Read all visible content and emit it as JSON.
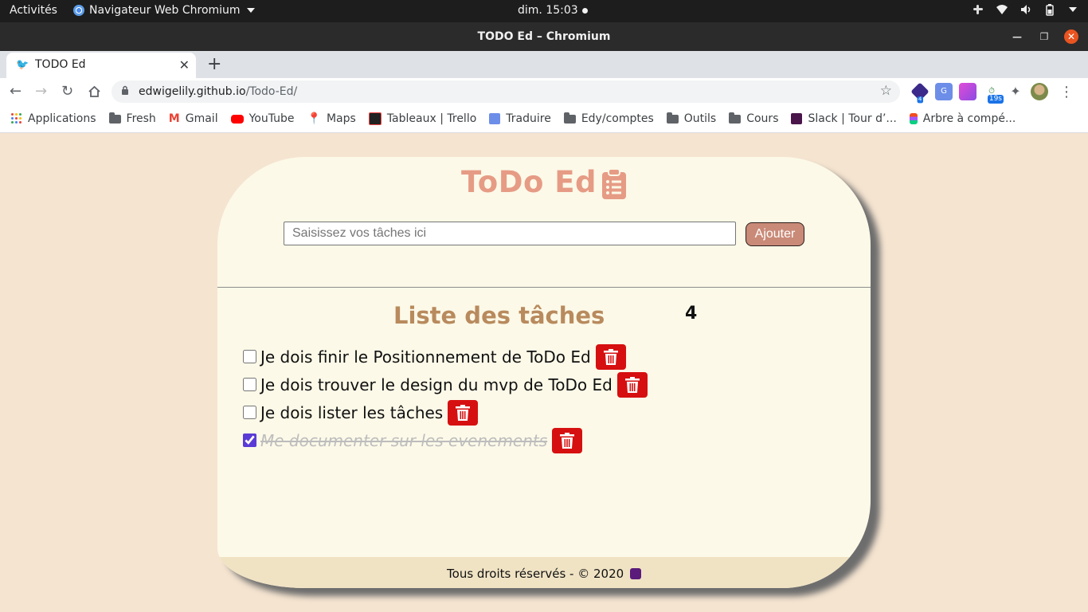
{
  "system": {
    "activities": "Activités",
    "app_name": "Navigateur Web Chromium",
    "clock": "dim. 15:03"
  },
  "window": {
    "title": "TODO Ed – Chromium"
  },
  "tabs": [
    {
      "label": "TODO Ed"
    }
  ],
  "toolbar": {
    "url_host": "edwigelily.github.io",
    "url_path": "/Todo-Ed/",
    "extension_badges": {
      "ext1": "4",
      "ext5": "19s"
    }
  },
  "bookmarks": [
    {
      "label": "Applications",
      "icon": "apps-grid-icon"
    },
    {
      "label": "Fresh",
      "icon": "folder-icon"
    },
    {
      "label": "Gmail",
      "icon": "gmail-icon"
    },
    {
      "label": "YouTube",
      "icon": "youtube-icon"
    },
    {
      "label": "Maps",
      "icon": "maps-icon"
    },
    {
      "label": "Tableaux | Trello",
      "icon": "trello-icon"
    },
    {
      "label": "Traduire",
      "icon": "translate-icon"
    },
    {
      "label": "Edy/comptes",
      "icon": "folder-icon"
    },
    {
      "label": "Outils",
      "icon": "folder-icon"
    },
    {
      "label": "Cours",
      "icon": "folder-icon"
    },
    {
      "label": "Slack | Tour d’...",
      "icon": "slack-icon"
    },
    {
      "label": "Arbre à compé...",
      "icon": "figma-icon"
    }
  ],
  "app": {
    "title": "ToDo Ed",
    "input_placeholder": "Saisissez vos tâches ici",
    "add_label": "Ajouter",
    "list_title": "Liste des tâches",
    "count": "4",
    "tasks": [
      {
        "text": "Je dois finir le Positionnement de ToDo Ed",
        "done": false
      },
      {
        "text": "Je dois trouver le design du mvp de ToDo Ed",
        "done": false
      },
      {
        "text": "Je dois lister les tâches",
        "done": false
      },
      {
        "text": "Me documenter sur les evenements",
        "done": true
      }
    ],
    "footer": "Tous droits réservés - © 2020"
  },
  "colors": {
    "title": "#e69b85",
    "list_title": "#b88a5d",
    "trash": "#d61010",
    "add_button": "#c98a78",
    "card": "#fcf9e8",
    "page_bg": "#f5e4d0"
  }
}
